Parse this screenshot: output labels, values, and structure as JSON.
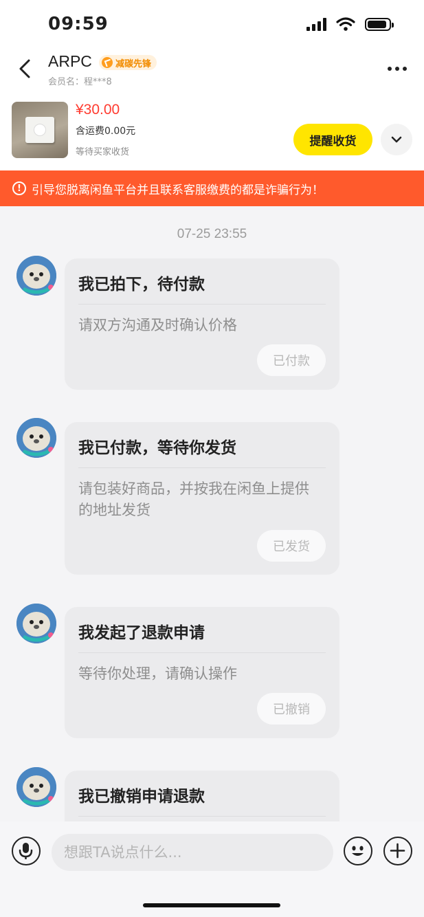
{
  "status_bar": {
    "time": "09:59",
    "icons": [
      "cellular-signal-icon",
      "wifi-icon",
      "battery-icon"
    ],
    "battery_level": 0.9
  },
  "nav": {
    "title": "ARPC",
    "badge": "减碳先锋",
    "member": "会员名：程***8",
    "icons": [
      "back-chevron-icon",
      "more-dots-icon"
    ]
  },
  "product": {
    "price": "¥30.00",
    "shipping": "含运费0.00元",
    "status": "等待买家收货",
    "remind_label": "提醒收货",
    "expand_icon": "chevron-down-icon"
  },
  "warning": {
    "icon": "!",
    "text": "引导您脱离闲鱼平台并且联系客服缴费的都是诈骗行为！"
  },
  "chat": {
    "timestamp": "07-25 23:55",
    "messages": [
      {
        "title": "我已拍下，待付款",
        "desc": "请双方沟通及时确认价格",
        "button": "已付款"
      },
      {
        "title": "我已付款，等待你发货",
        "desc": "请包装好商品，并按我在闲鱼上提供的地址发货",
        "button": "已发货"
      },
      {
        "title": "我发起了退款申请",
        "desc": "等待你处理，请确认操作",
        "button": "已撤销"
      },
      {
        "title": "我已撤销申请退款"
      }
    ]
  },
  "input_bar": {
    "placeholder": "想跟TA说点什么...",
    "icons": [
      "microphone-icon",
      "emoji-icon",
      "plus-icon"
    ]
  },
  "colors": {
    "accent_yellow": "#ffe500",
    "warning_orange": "#ff5a2c",
    "price_red": "#ff3b30",
    "badge_orange": "#f28c00"
  }
}
